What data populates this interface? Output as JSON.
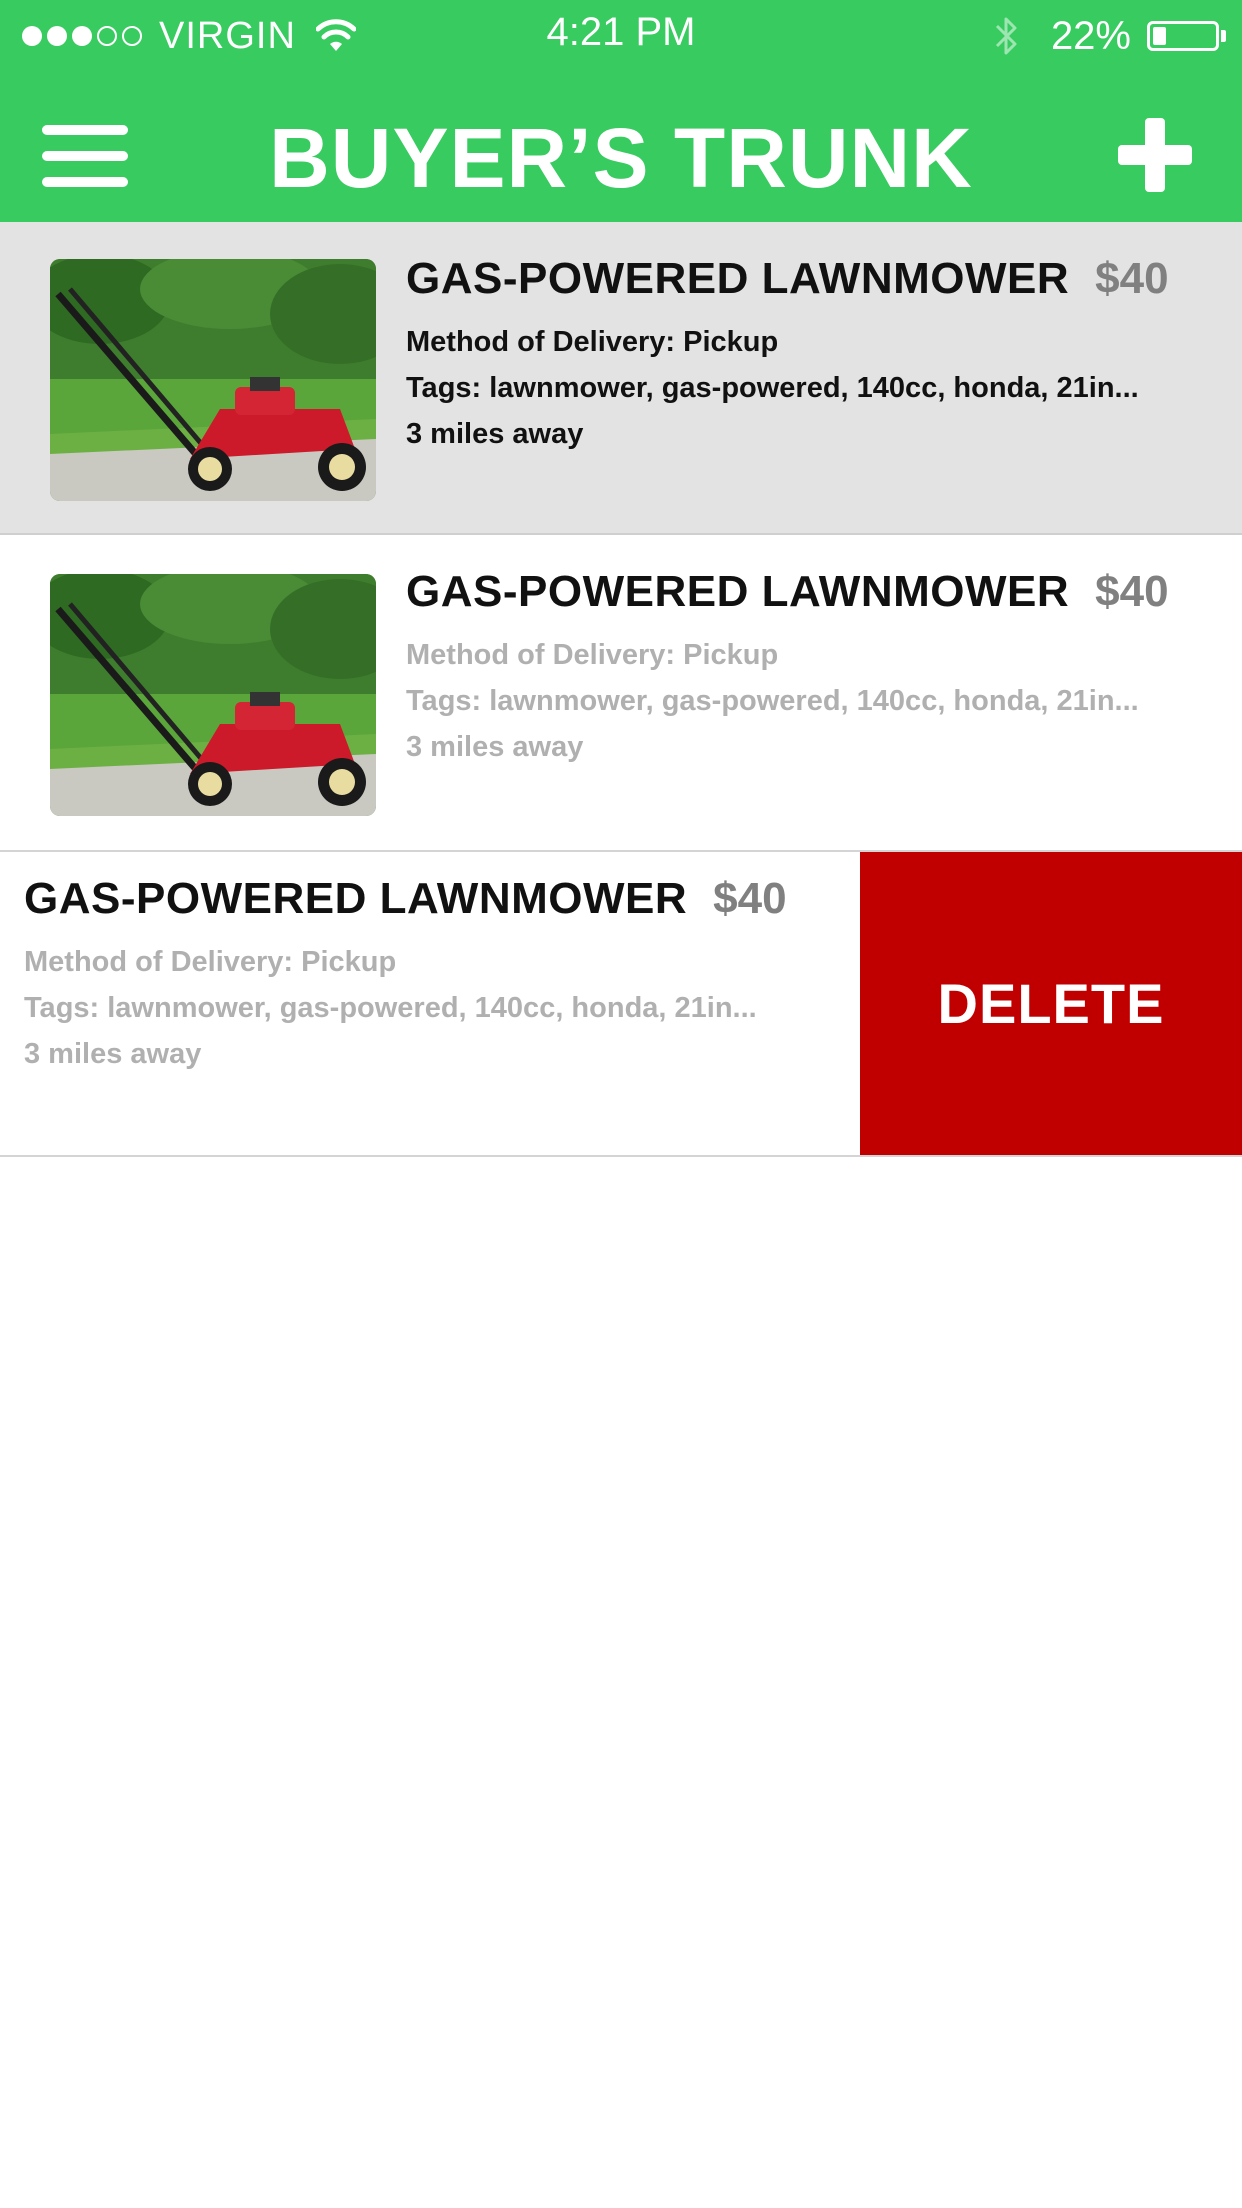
{
  "status_bar": {
    "carrier": "VIRGIN",
    "time": "4:21 PM",
    "battery_percent": "22%",
    "battery_level": 0.22,
    "signal_bars": 3,
    "signal_total": 5
  },
  "nav": {
    "title": "BUYER’S TRUNK",
    "menu_icon": "hamburger-menu-icon",
    "add_icon": "plus-icon"
  },
  "colors": {
    "brand_green": "#37cb60",
    "delete_red": "#c00000",
    "selected_row": "#e3e3e3"
  },
  "items": [
    {
      "title": "GAS-POWERED LAWNMOWER",
      "price": "$40",
      "delivery": "Method of Delivery: Pickup",
      "tags": "Tags: lawnmower, gas-powered, 140cc, honda, 21in...",
      "distance": "3 miles away"
    },
    {
      "title": "GAS-POWERED LAWNMOWER",
      "price": "$40",
      "delivery": "Method of Delivery: Pickup",
      "tags": "Tags: lawnmower, gas-powered, 140cc, honda, 21in...",
      "distance": "3 miles away"
    },
    {
      "title": "GAS-POWERED LAWNMOWER",
      "price": "$40",
      "delivery": "Method of Delivery: Pickup",
      "tags": "Tags: lawnmower, gas-powered, 140cc, honda, 21in...",
      "distance": "3 miles away",
      "delete_label": "DELETE"
    }
  ]
}
